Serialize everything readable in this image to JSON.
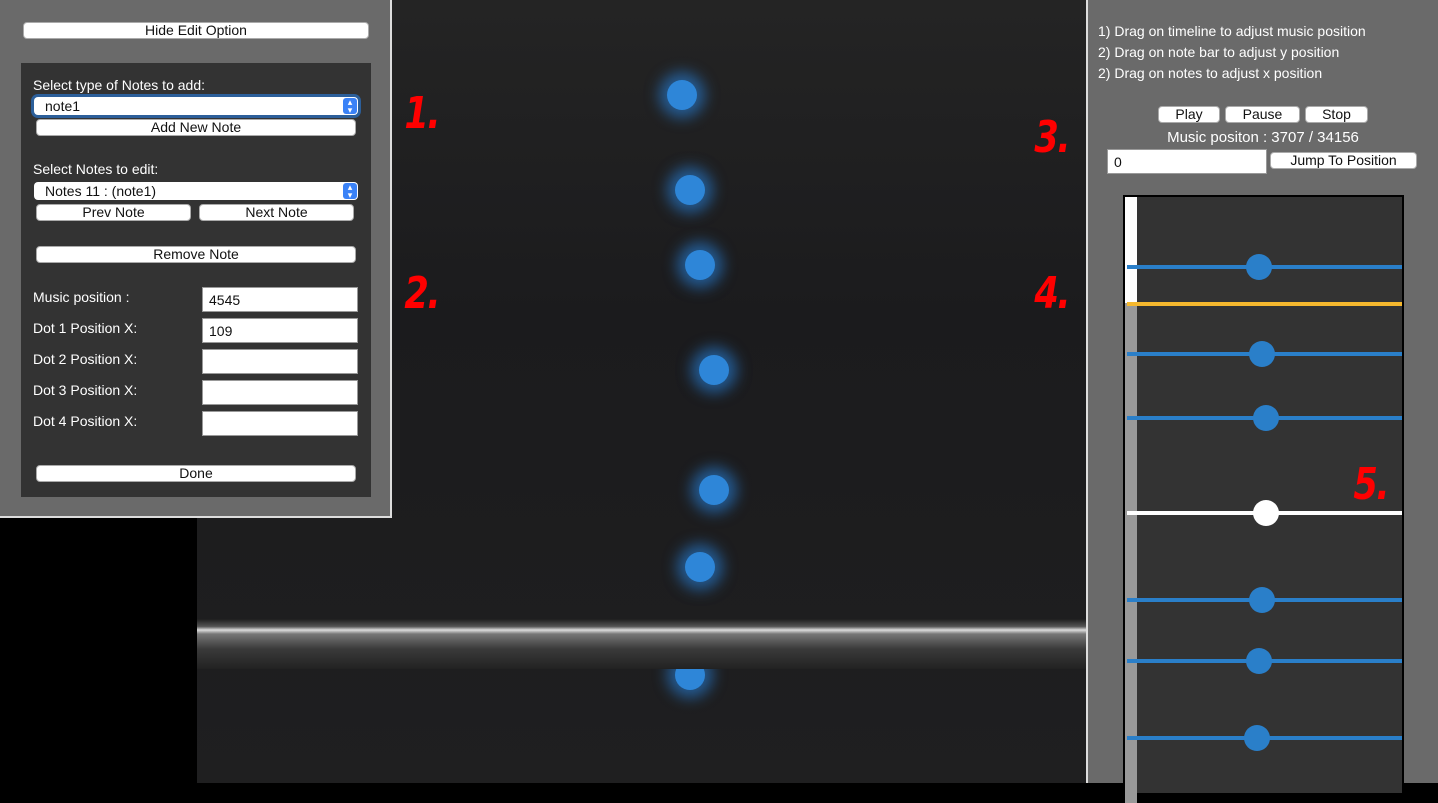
{
  "edit_panel": {
    "hide_button": "Hide Edit Option",
    "add_label": "Select type of Notes to add:",
    "add_select": "note1",
    "add_button": "Add New Note",
    "edit_label": "Select Notes to edit:",
    "edit_select": "Notes 11 : (note1)",
    "prev_button": "Prev Note",
    "next_button": "Next Note",
    "remove_button": "Remove Note",
    "fields": [
      {
        "label": "Music position :",
        "value": "4545"
      },
      {
        "label": "Dot 1 Position X:",
        "value": "109"
      },
      {
        "label": "Dot 2 Position X:",
        "value": ""
      },
      {
        "label": "Dot 3 Position X:",
        "value": ""
      },
      {
        "label": "Dot 4 Position X:",
        "value": ""
      }
    ],
    "done_button": "Done"
  },
  "annotations": [
    "1.",
    "2.",
    "3.",
    "4.",
    "5."
  ],
  "control_panel": {
    "instructions": [
      "1) Drag on timeline to adjust music position",
      "2) Drag on note bar to adjust y position",
      "2) Drag on notes to adjust x position"
    ],
    "play": "Play",
    "pause": "Pause",
    "stop": "Stop",
    "music_position": "Music positon : 3707 / 34156",
    "jump_input": "0",
    "jump_button": "Jump To Position"
  },
  "colors": {
    "note": "#2a7fc9",
    "current": "#f5b82e",
    "selected": "#ffffff",
    "annotation": "#ff0000"
  }
}
